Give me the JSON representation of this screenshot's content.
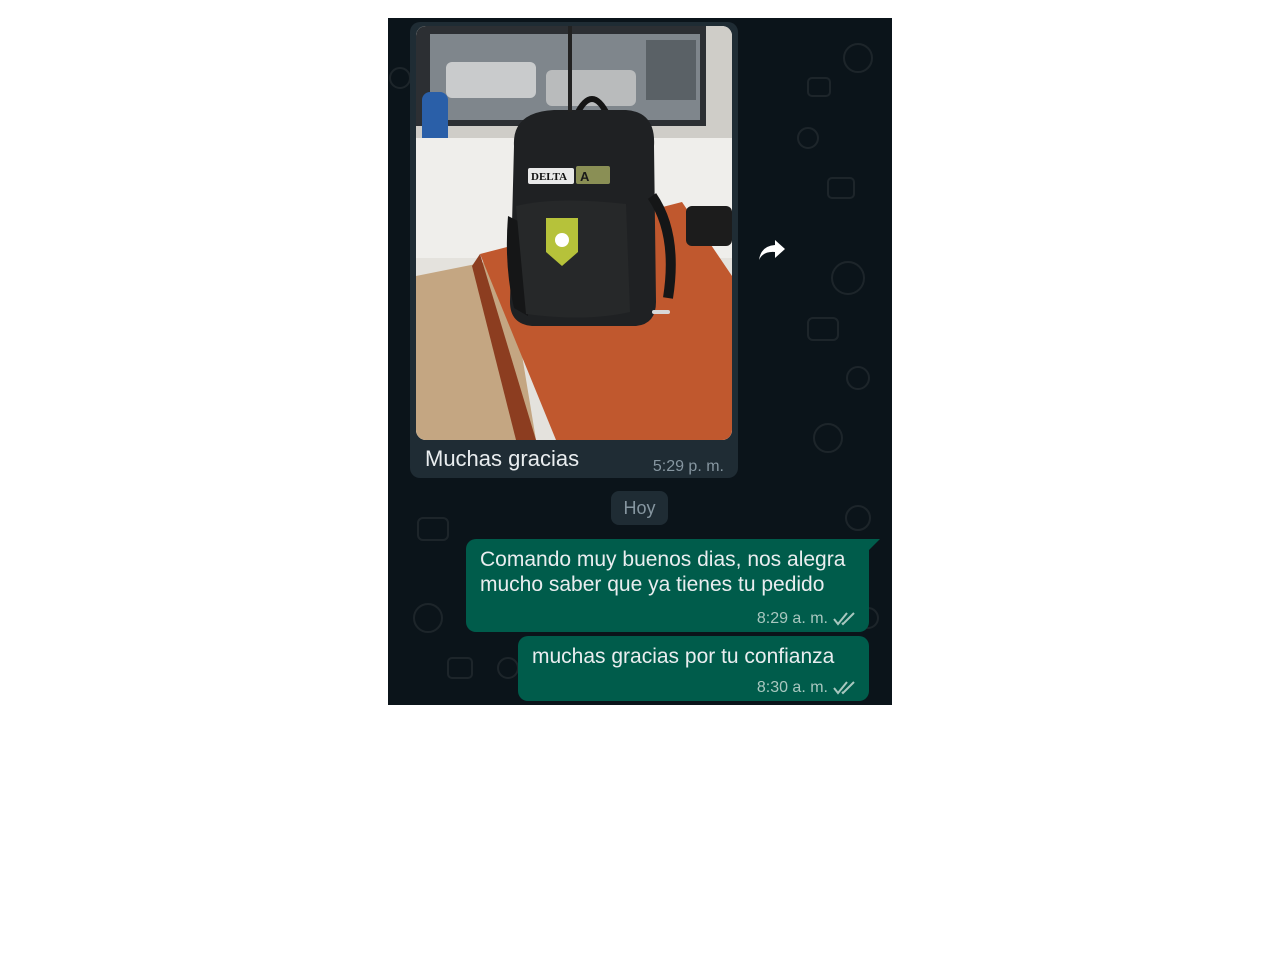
{
  "messages": {
    "incoming": {
      "caption": "Muchas gracias",
      "time": "5:29 p. m.",
      "photo_patches": [
        "DELTA",
        "A"
      ]
    },
    "date_divider": "Hoy",
    "outgoing": [
      {
        "text": "Comando muy buenos dias, nos alegra mucho saber que ya tienes tu pedido",
        "time": "8:29 a. m."
      },
      {
        "text": "muchas gracias por tu confianza",
        "time": "8:30 a. m."
      }
    ]
  },
  "icons": {
    "forward": "forward-icon",
    "read_receipt": "double-check-icon"
  },
  "colors": {
    "chat_bg": "#0b141a",
    "incoming_bubble": "#1f2c34",
    "outgoing_bubble": "#005c4b",
    "read_receipt": "#a8c7bf"
  }
}
